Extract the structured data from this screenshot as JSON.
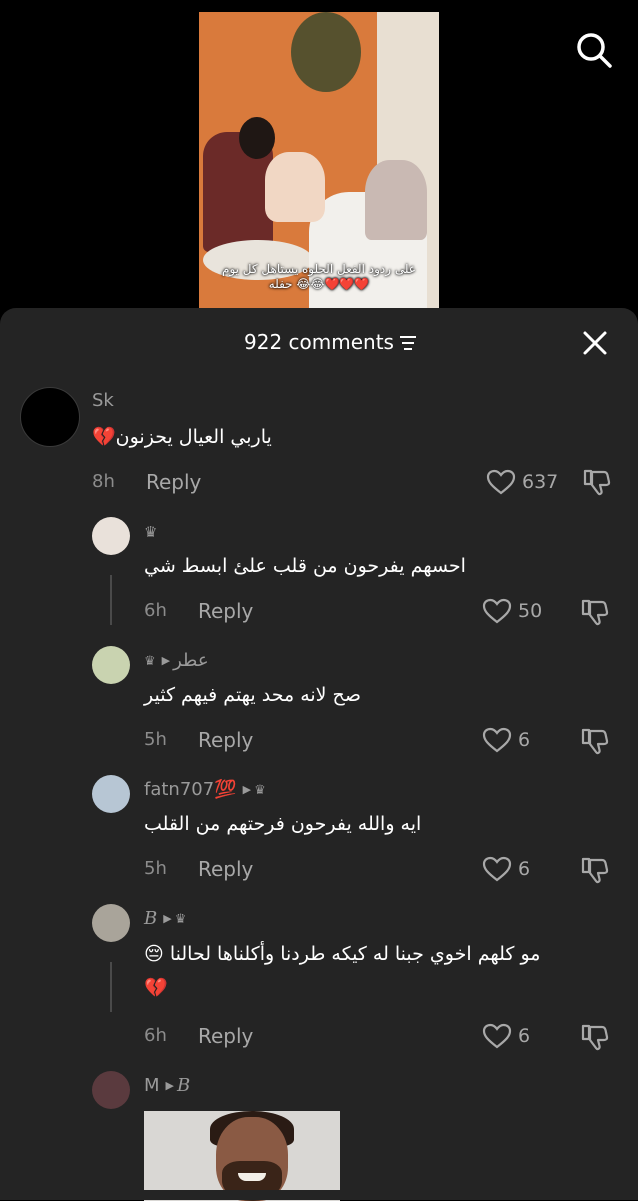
{
  "video": {
    "caption_line1": "على ردود الفعل الحلوه يستاهل كل يوم",
    "caption_line2": "حفله 😂😂❤️❤️❤️"
  },
  "header": {
    "comment_count": "922 comments"
  },
  "comments": [
    {
      "user": "Sk",
      "text": "ياربي العيال يحزنون💔",
      "time": "8h",
      "reply": "Reply",
      "likes": "637"
    },
    {
      "user": "♛",
      "text": "احسهم يفرحون من قلب علئ ابسط شي",
      "time": "6h",
      "reply": "Reply",
      "likes": "50"
    },
    {
      "user": "عطر",
      "reply_to": "♛",
      "text": "صح لانه محد يهتم فيهم كثير",
      "time": "5h",
      "reply": "Reply",
      "likes": "6"
    },
    {
      "user": "fatn707💯",
      "reply_to": "♛",
      "text": "ايه والله يفرحون فرحتهم من القلب",
      "time": "5h",
      "reply": "Reply",
      "likes": "6"
    },
    {
      "user": "B",
      "reply_to": "♛",
      "text": "مو كلهم اخوي جبنا له كيكه طردنا وأكلناها لحالنا 😔",
      "text2": "💔",
      "time": "6h",
      "reply": "Reply",
      "likes": "6"
    },
    {
      "user": "M",
      "reply_to": "B"
    }
  ],
  "icons": {
    "search": "search-icon",
    "filter": "filter-icon",
    "close": "close-icon",
    "like": "heart-icon",
    "dislike": "dislike-icon"
  },
  "colors": {
    "sheet_bg": "#242424",
    "muted_text": "#8c8c8c"
  }
}
